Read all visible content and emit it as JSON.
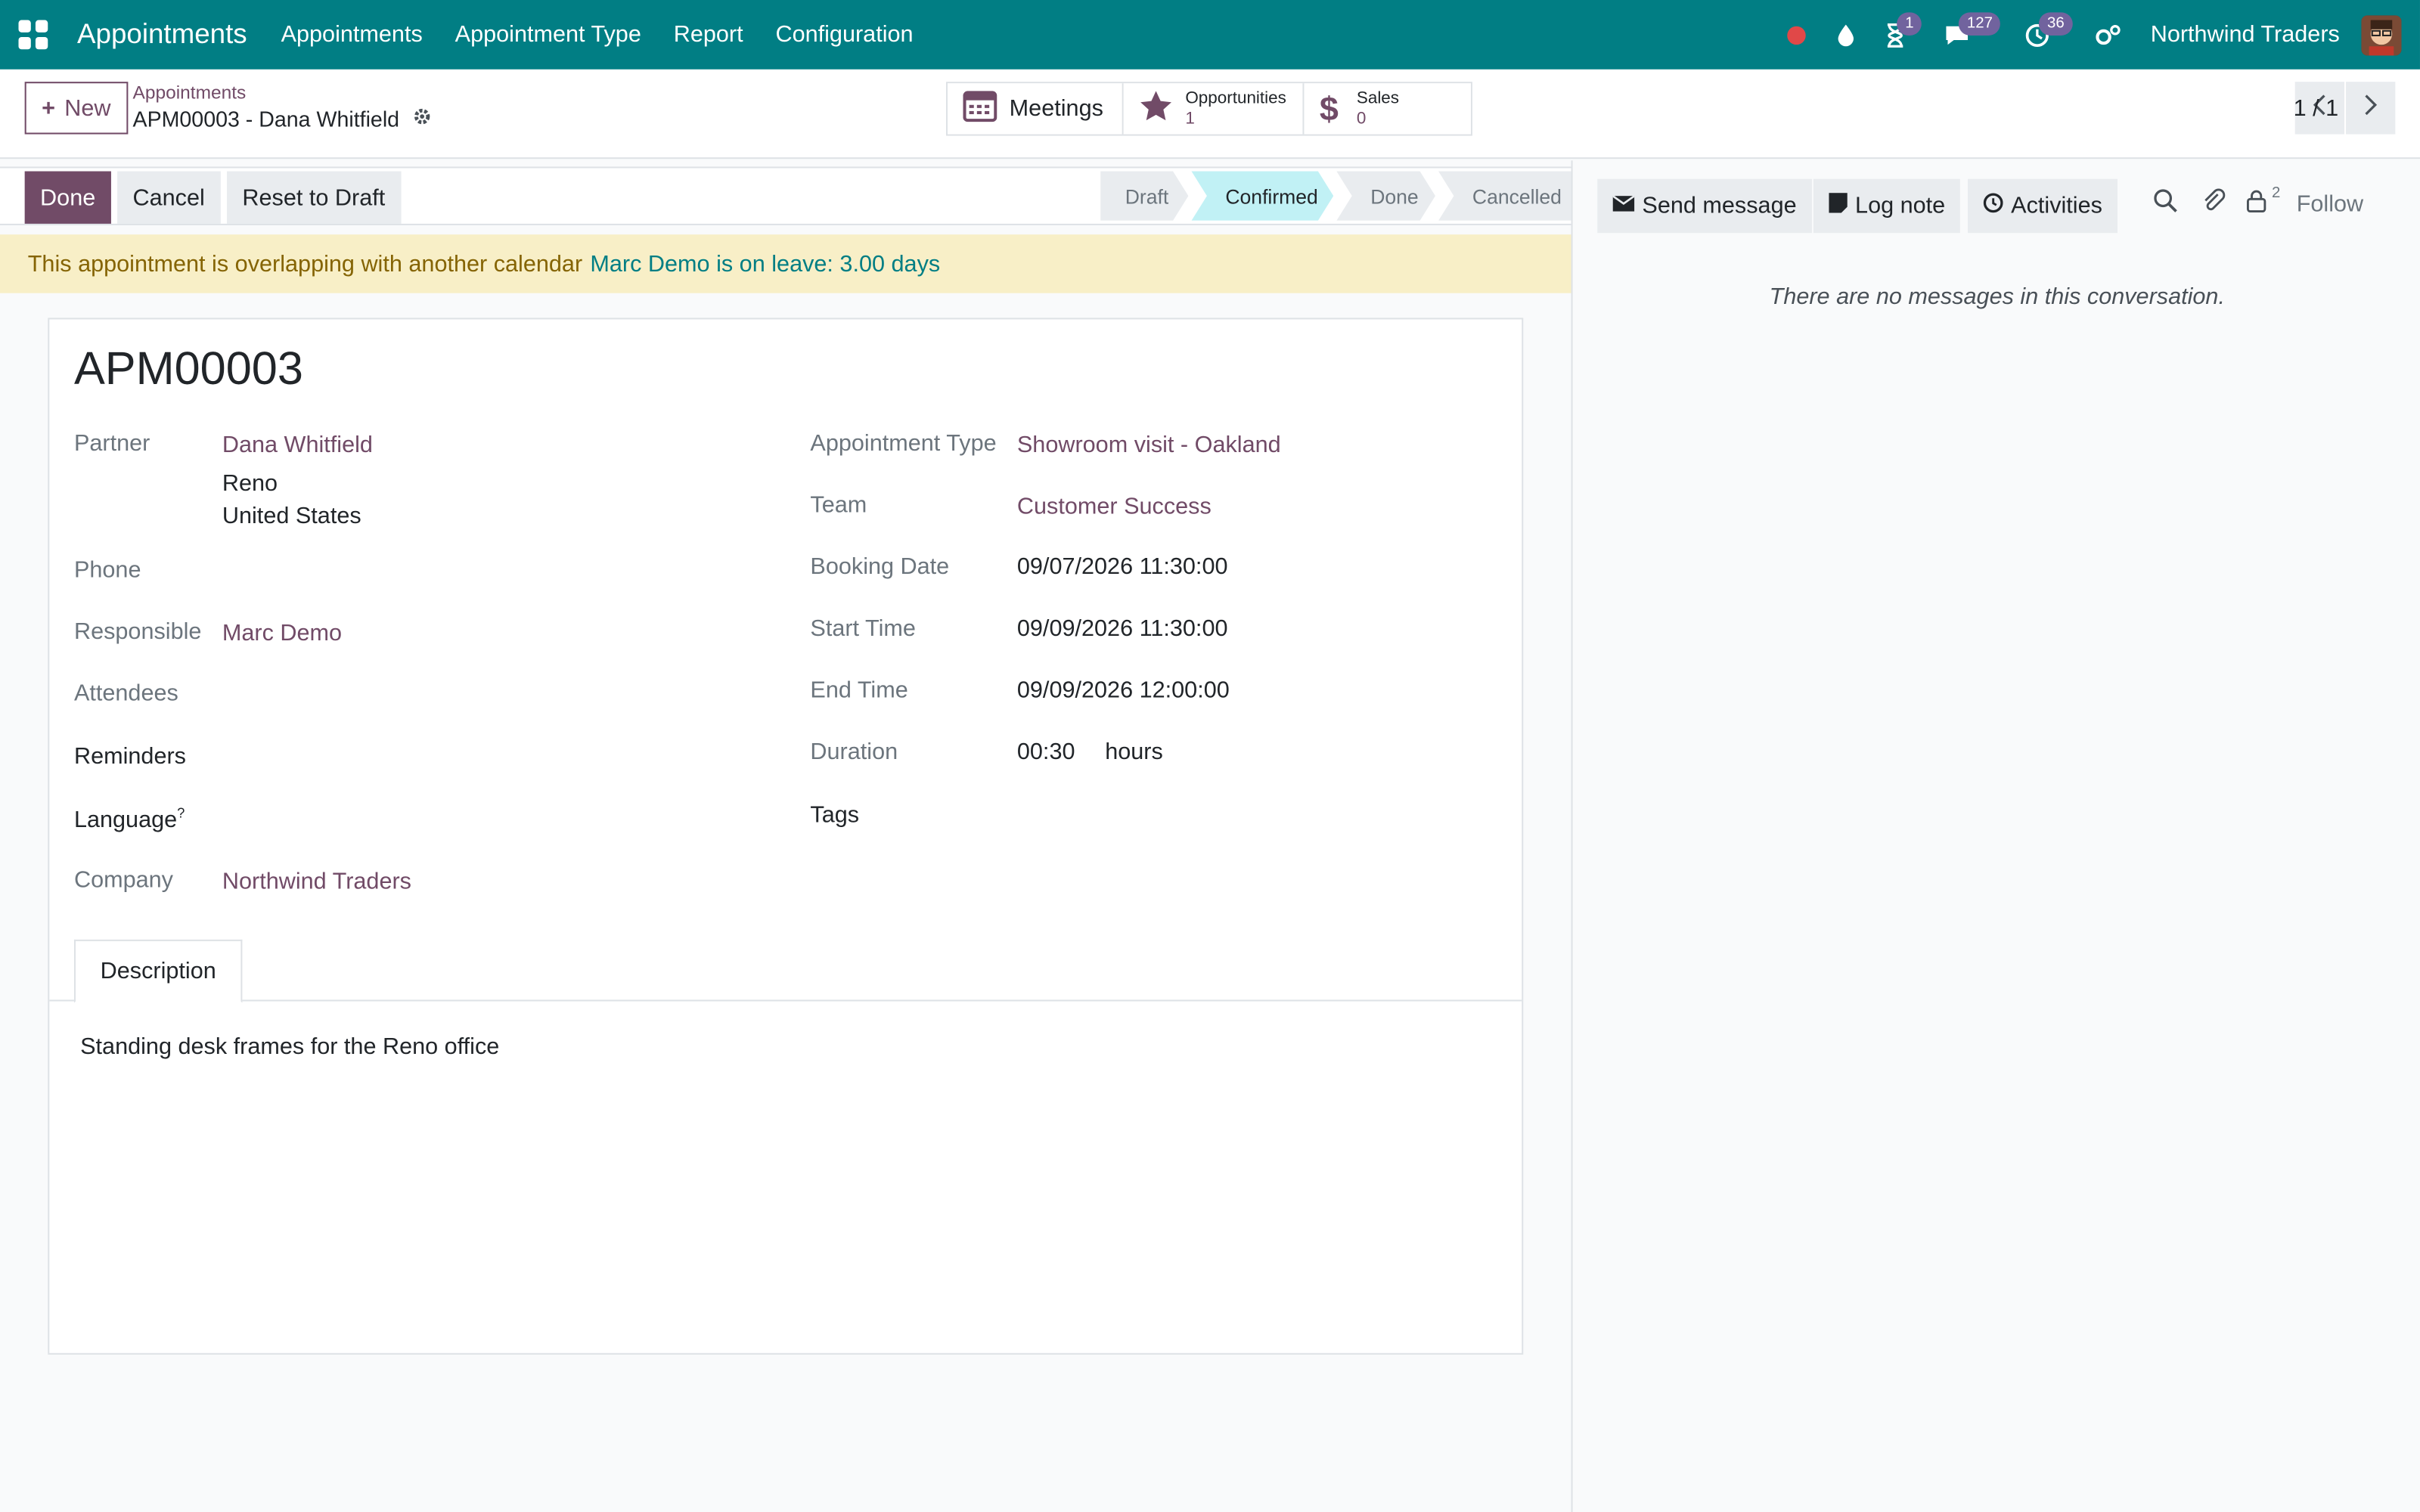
{
  "topnav": {
    "brand": "Appointments",
    "menu": [
      "Appointments",
      "Appointment Type",
      "Report",
      "Configuration"
    ],
    "badges": {
      "activity": "1",
      "messages": "127",
      "timer": "36"
    },
    "company": "Northwind Traders"
  },
  "control": {
    "new_label": "New",
    "breadcrumb_parent": "Appointments",
    "breadcrumb_current": "APM00003 - Dana Whitfield",
    "smart_buttons": {
      "meetings": "Meetings",
      "opportunities_label": "Opportunities",
      "opportunities_count": "1",
      "sales_label": "Sales",
      "sales_count": "0"
    },
    "pager": "1 / 1"
  },
  "statusbar": {
    "buttons": {
      "done": "Done",
      "cancel": "Cancel",
      "reset": "Reset to Draft"
    },
    "stages": [
      "Draft",
      "Confirmed",
      "Done",
      "Cancelled"
    ],
    "active_stage": "Confirmed"
  },
  "warning": {
    "text": "This appointment is overlapping with another calendar",
    "link": "Marc Demo is on leave: 3.00 days"
  },
  "form": {
    "record": "APM00003",
    "labels": {
      "partner": "Partner",
      "phone": "Phone",
      "responsible": "Responsible",
      "attendees": "Attendees",
      "reminders": "Reminders",
      "language": "Language",
      "language_help": "?",
      "company": "Company",
      "appointment_type": "Appointment Type",
      "team": "Team",
      "booking_date": "Booking Date",
      "start_time": "Start Time",
      "end_time": "End Time",
      "duration": "Duration",
      "tags": "Tags"
    },
    "values": {
      "partner": "Dana Whitfield",
      "partner_city": "Reno",
      "partner_country": "United States",
      "responsible": "Marc Demo",
      "company": "Northwind Traders",
      "appointment_type": "Showroom visit - Oakland",
      "team": "Customer Success",
      "booking_date": "09/07/2026 11:30:00",
      "start_time": "09/09/2026 11:30:00",
      "end_time": "09/09/2026 12:00:00",
      "duration": "00:30",
      "duration_unit": "hours"
    },
    "tab": "Description",
    "description": "Standing desk frames for the Reno office"
  },
  "chatter": {
    "send_message": "Send message",
    "log_note": "Log note",
    "activities": "Activities",
    "followers_count": "2",
    "follow": "Follow",
    "empty": "There are no messages in this conversation."
  },
  "colors": {
    "nav": "#017e84",
    "primary": "#714b67",
    "stage_active": "#c1f1f5",
    "warning_bg": "#f8efc7"
  }
}
